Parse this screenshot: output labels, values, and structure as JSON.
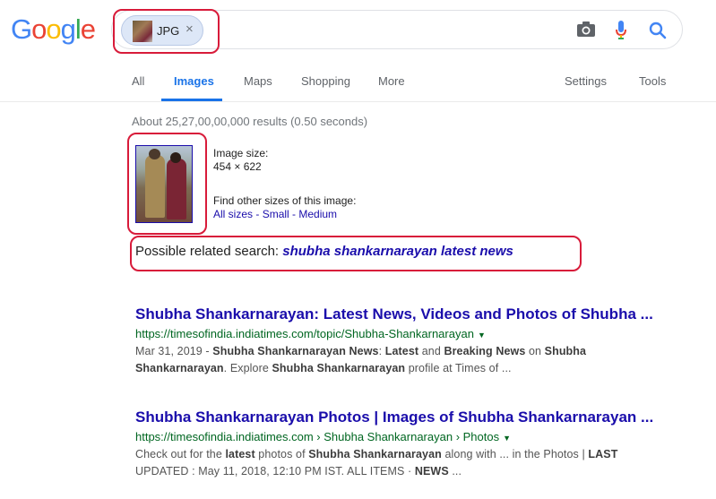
{
  "logo": {
    "letters": [
      "G",
      "o",
      "o",
      "g",
      "l",
      "e"
    ],
    "colors": [
      "#4285f4",
      "#ea4335",
      "#fbbc05",
      "#4285f4",
      "#34a853",
      "#ea4335"
    ]
  },
  "search": {
    "chip_label": "JPG",
    "chip_close": "×"
  },
  "tabs": {
    "all": "All",
    "images": "Images",
    "maps": "Maps",
    "shopping": "Shopping",
    "more": "More",
    "settings": "Settings",
    "tools": "Tools"
  },
  "stats": "About 25,27,00,00,000 results (0.50 seconds)",
  "image_info": {
    "size_label": "Image size:",
    "size_value": "454 × 622",
    "find_label": "Find other sizes of this image:",
    "all_sizes": "All sizes",
    "sep1": " - ",
    "small": "Small",
    "sep2": " - ",
    "medium": "Medium"
  },
  "related": {
    "label": "Possible related search: ",
    "query": "shubha shankarnarayan latest news"
  },
  "results": [
    {
      "title": "Shubha Shankarnarayan: Latest News, Videos and Photos of Shubha ...",
      "url": "https://timesofindia.indiatimes.com/topic/Shubha-Shankarnarayan",
      "snippet_line1_parts": [
        "Mar 31, 2019 - ",
        "Shubha Shankarnarayan News",
        ": ",
        "Latest",
        " and ",
        "Breaking News",
        " on ",
        "Shubha"
      ],
      "snippet_line2_parts": [
        "Shankarnarayan",
        ". Explore ",
        "Shubha Shankarnarayan",
        " profile at Times of ..."
      ]
    },
    {
      "title": "Shubha Shankarnarayan Photos | Images of Shubha Shankarnarayan ...",
      "url": "https://timesofindia.indiatimes.com › Shubha Shankarnarayan › Photos",
      "snippet_line1_parts": [
        "Check out for the ",
        "latest",
        " photos of ",
        "Shubha Shankarnarayan",
        " along with ... in the Photos | ",
        "LAST"
      ],
      "snippet_line2_parts": [
        "UPDATED",
        " : May 11, 2018, 12:10 PM IST. ALL ITEMS · ",
        "NEWS",
        " ..."
      ]
    }
  ],
  "icons": {
    "camera": "camera-icon",
    "mic": "mic-icon",
    "search": "search-icon"
  }
}
